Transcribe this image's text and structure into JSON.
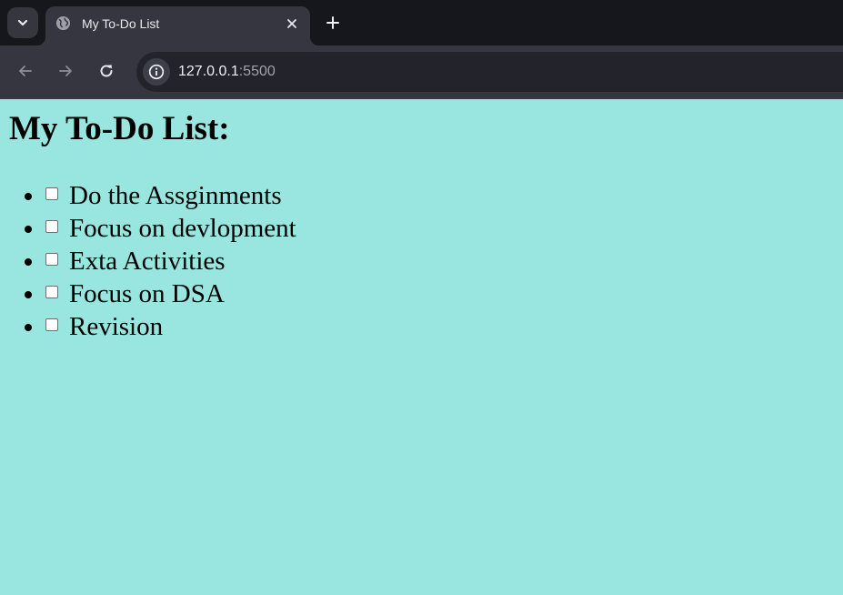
{
  "browser": {
    "tab": {
      "title": "My To-Do List"
    },
    "address": {
      "host": "127.0.0.1",
      "port": ":5500"
    },
    "icons": {
      "tab_search": "chevron-down-icon",
      "favicon": "globe-icon",
      "close": "close-icon",
      "new_tab": "plus-icon",
      "back": "arrow-left-icon",
      "forward": "arrow-right-icon",
      "reload": "reload-icon",
      "site_info": "info-icon"
    }
  },
  "page": {
    "background": "#98e6df",
    "heading": "My To-Do List:",
    "items": [
      {
        "label": "Do the Assginments",
        "checked": false
      },
      {
        "label": "Focus on devlopment",
        "checked": false
      },
      {
        "label": "Exta Activities",
        "checked": false
      },
      {
        "label": "Focus on DSA",
        "checked": false
      },
      {
        "label": "Revision",
        "checked": false
      }
    ]
  }
}
